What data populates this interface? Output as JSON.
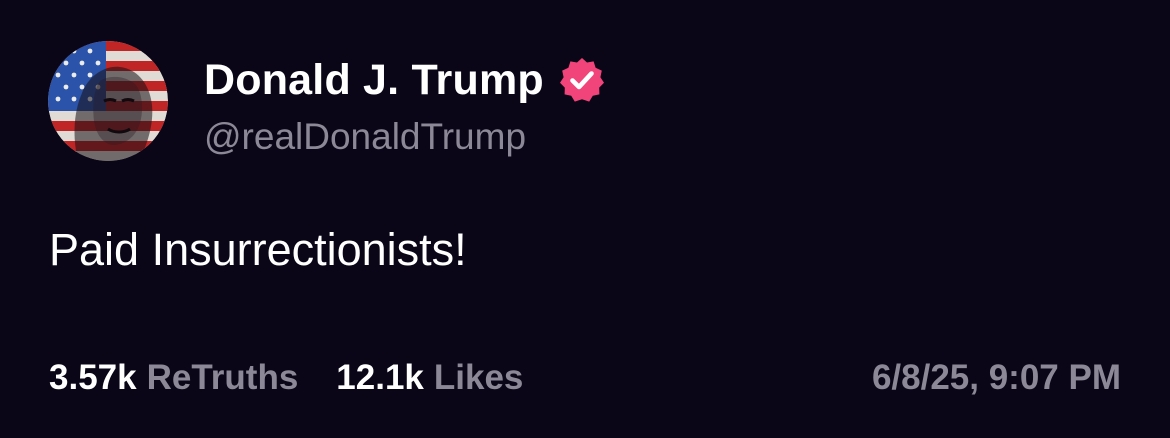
{
  "author": {
    "display_name": "Donald J. Trump",
    "handle": "@realDonaldTrump",
    "verified_badge_color": "#f0447a"
  },
  "post": {
    "text": "Paid Insurrectionists!"
  },
  "stats": {
    "retruths_count": "3.57k",
    "retruths_label": "ReTruths",
    "likes_count": "12.1k",
    "likes_label": "Likes"
  },
  "timestamp": "6/8/25, 9:07 PM",
  "colors": {
    "background": "#0a0617",
    "primary_text": "#ffffff",
    "secondary_text": "#8c8898"
  }
}
